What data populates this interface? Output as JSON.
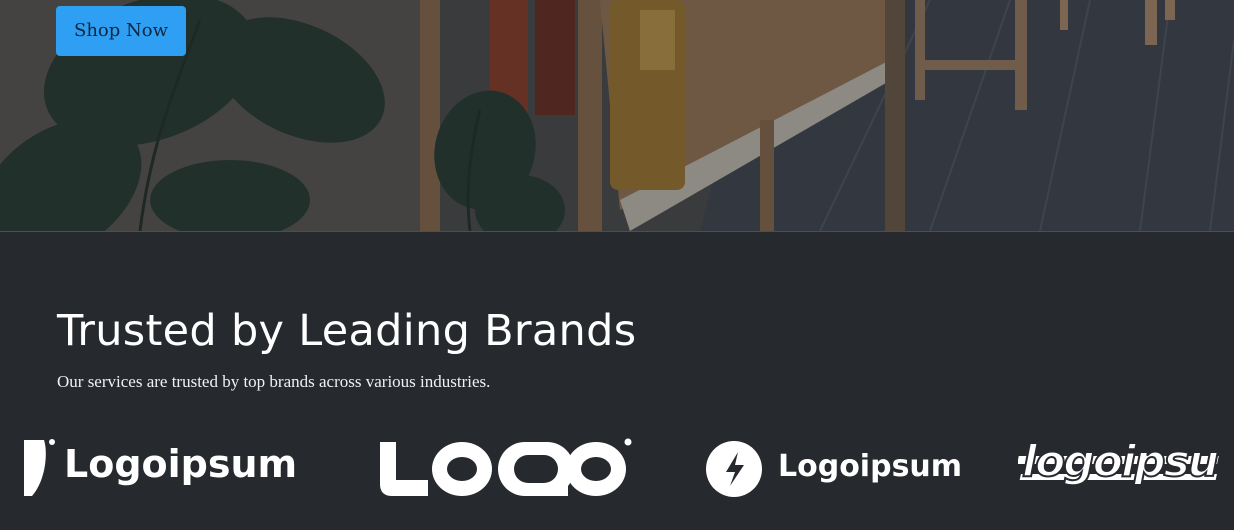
{
  "hero": {
    "cta_label": "Shop Now"
  },
  "brands": {
    "title": "Trusted by Leading Brands",
    "subtitle": "Our services are trusted by top brands across various industries.",
    "logos": [
      {
        "text": "Logoipsum",
        "icon": "brand-mark-icon"
      },
      {
        "text": "LOQO",
        "icon": "loqo-wordmark"
      },
      {
        "text": "Logoipsum",
        "icon": "bolt-circle-icon"
      },
      {
        "text": "logoipsu",
        "icon": "italic-wordmark"
      }
    ]
  },
  "colors": {
    "cta": "#2f9ff4",
    "section_bg": "#262a2e",
    "text": "#ffffff"
  }
}
